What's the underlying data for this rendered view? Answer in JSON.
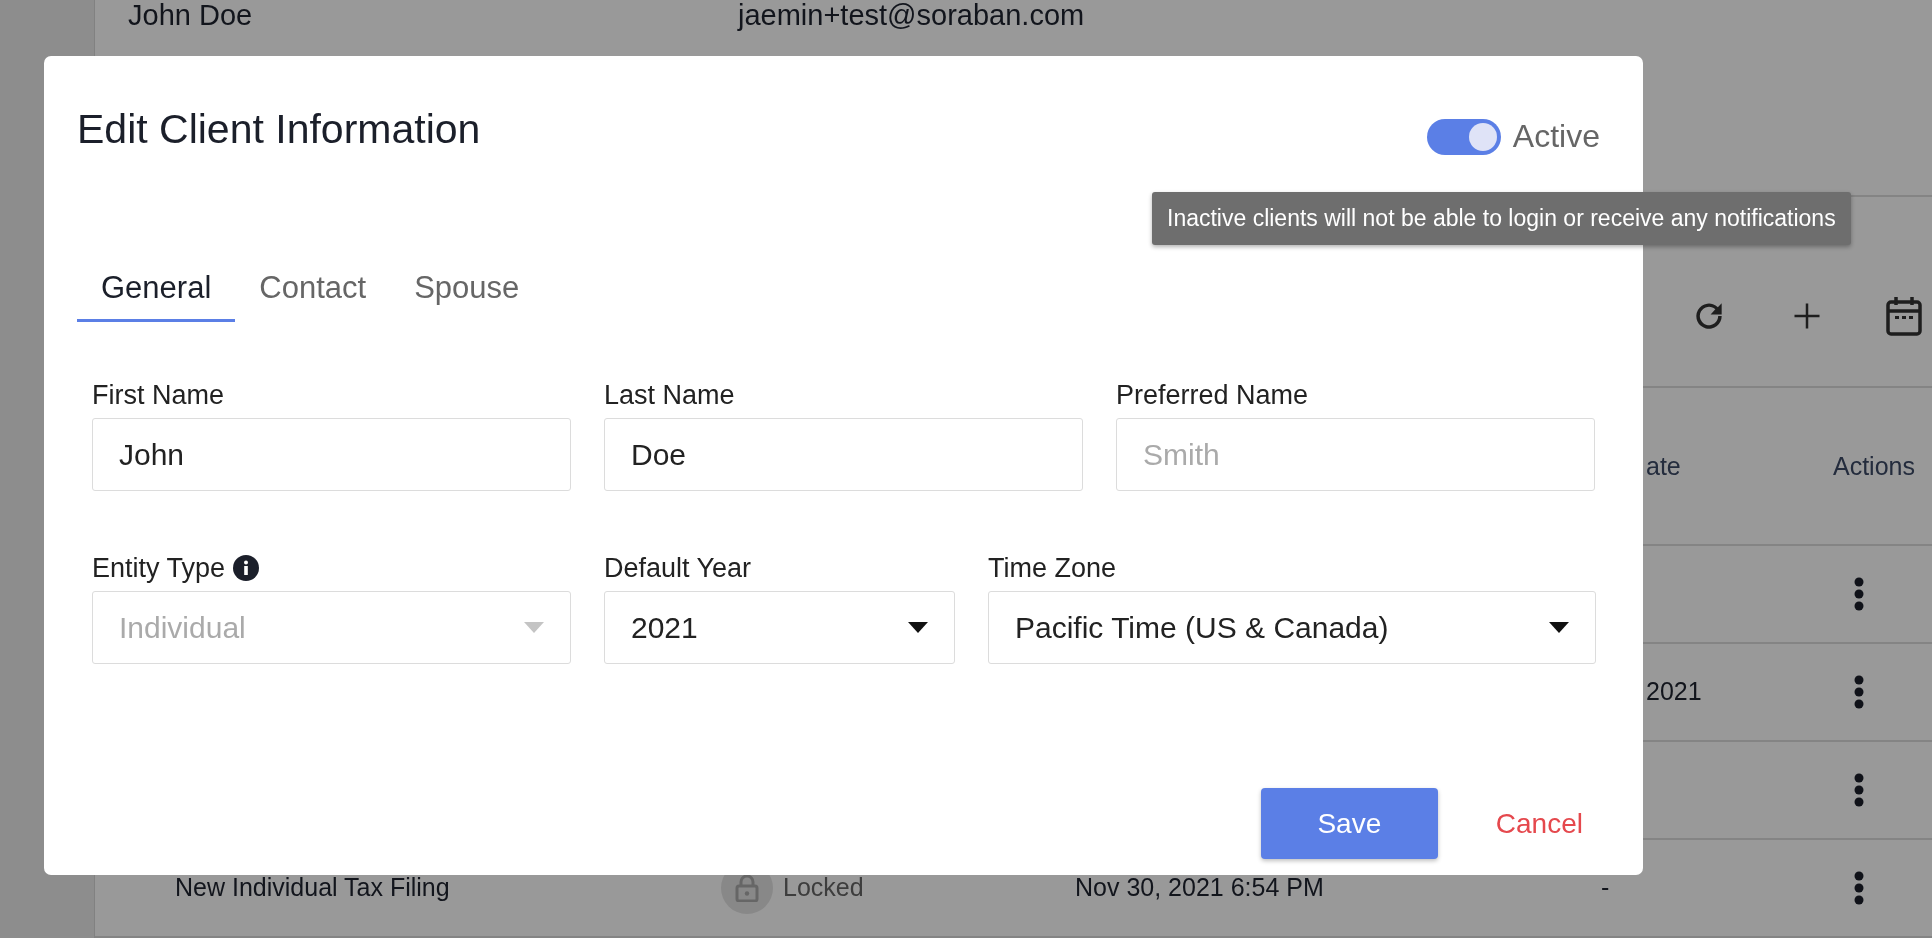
{
  "background": {
    "client": {
      "name": "John Doe",
      "email": "jaemin+test@soraban.com"
    },
    "table": {
      "columns": [
        {
          "label": "ate"
        },
        {
          "label": "Actions"
        }
      ],
      "rows": [
        {
          "column_4": ""
        },
        {
          "column_4": "2021"
        },
        {
          "column_4": ""
        },
        {
          "name": "New Individual Tax Filing",
          "status": "Locked",
          "date": "Nov 30, 2021 6:54 PM",
          "column_4": "-"
        }
      ]
    }
  },
  "dialog": {
    "title": "Edit Client Information",
    "active_toggle": {
      "label": "Active",
      "on": true
    },
    "tooltip": "Inactive clients will not be able to login or receive any notifications",
    "tabs": [
      {
        "label": "General",
        "selected": true
      },
      {
        "label": "Contact",
        "selected": false
      },
      {
        "label": "Spouse",
        "selected": false
      }
    ],
    "field_rows": [
      [
        {
          "kind": "text",
          "label": "First Name",
          "value": "John"
        },
        {
          "kind": "text",
          "label": "Last Name",
          "value": "Doe"
        },
        {
          "kind": "text",
          "label": "Preferred Name",
          "placeholder": "Smith"
        }
      ],
      [
        {
          "kind": "select",
          "label": "Entity Type",
          "value": "Individual",
          "disabled": true,
          "info": true
        },
        {
          "kind": "select",
          "label": "Default Year",
          "value": "2021",
          "disabled": false,
          "info": false
        },
        {
          "kind": "select",
          "label": "Time Zone",
          "value": "Pacific Time (US & Canada)",
          "disabled": false,
          "info": false
        }
      ]
    ],
    "buttons": [
      {
        "kind": "primary",
        "label": "Save"
      },
      {
        "kind": "link",
        "label": "Cancel"
      }
    ]
  }
}
